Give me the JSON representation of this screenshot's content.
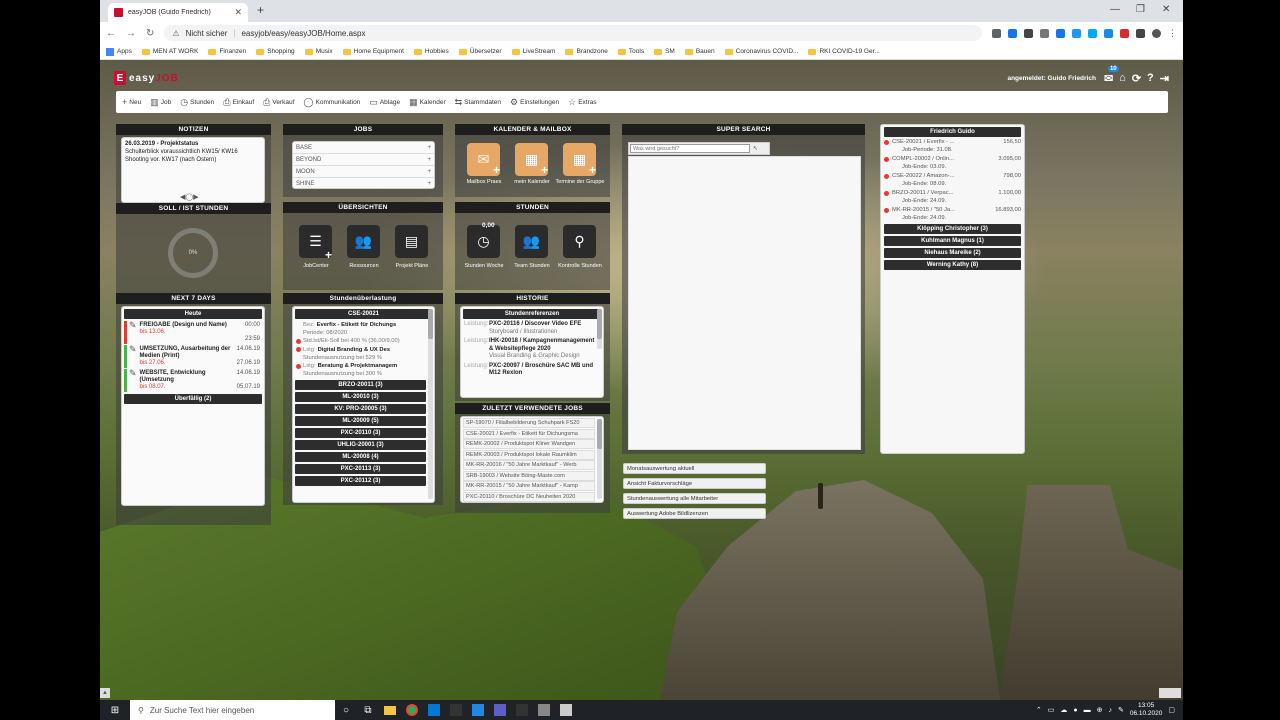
{
  "browser": {
    "tab_title": "easyJOB (Guido Friedrich)",
    "security_label": "Nicht sicher",
    "url": "easyjob/easy/easyJOB/Home.aspx",
    "bookmarks": [
      "Apps",
      "MEN AT WORK",
      "Finanzen",
      "Shopping",
      "Musix",
      "Home Equipment",
      "Hobbies",
      "Übersetzer",
      "LiveStream",
      "Brandzone",
      "Tools",
      "SM",
      "Bauen",
      "Coronavirus COVID...",
      "RKI COVID-19 Ger..."
    ]
  },
  "app": {
    "logo_easy": "easy",
    "logo_job": "JOB",
    "logged_in": "angemeldet: Guido Friedrich",
    "mail_badge": "10"
  },
  "toolbar": [
    "Neu",
    "Job",
    "Stunden",
    "Einkauf",
    "Verkauf",
    "Kommunikation",
    "Ablage",
    "Kalender",
    "Stammdaten",
    "Einstellungen",
    "Extras"
  ],
  "notizen": {
    "title": "NOTIZEN",
    "date_line": "26.03.2019 - Projektstatus",
    "line1": "Schulterblick voraussichtlich KW15/ KW16",
    "line2": "Shooting vor. KW17 (nach Ostern)"
  },
  "soll_ist": {
    "title": "SOLL / IST STUNDEN",
    "percent": "0%"
  },
  "next7": {
    "title": "NEXT 7 DAYS",
    "today": "Heute",
    "items": [
      {
        "title": "FREIGABE (Design und Name)",
        "time": "00:00",
        "due": "bis 13.06.",
        "time2": "23:59"
      },
      {
        "title": "UMSETZUNG, Ausarbeitung der Medien (Print)",
        "time": "14.06.19",
        "due": "bis 27.06.",
        "time2": "27.06.19"
      },
      {
        "title": "WEBSITE, Entwicklung (Umsetzung",
        "time": "14.06.19",
        "due": "bis 08.07.",
        "time2": "05.07.19"
      }
    ],
    "overdue": "Überfällig (2)"
  },
  "jobs": {
    "title": "JOBS",
    "items": [
      "BASE",
      "BEYOND",
      "MOON",
      "SHINE"
    ]
  },
  "uebersichten": {
    "title": "ÜBERSICHTEN",
    "items": [
      "JobCenter",
      "Ressourcen",
      "Projekt Pläne"
    ]
  },
  "stundenueber": {
    "title": "Stundenüberlastung",
    "head": "CSE-20021",
    "rows": [
      {
        "label": "Bez:",
        "text": "Everfix - Etikett für Dichungs",
        "bold": true,
        "dot": false
      },
      {
        "label": "",
        "text": "Periode: 08/2020",
        "bold": false,
        "dot": false
      },
      {
        "label": "",
        "text": "Std.Ist/Ek-Soll bei 400 % (36,00/9,00)",
        "bold": false,
        "dot": true
      },
      {
        "label": "Lstg:",
        "text": "Digital Branding & UX Des",
        "bold": true,
        "dot": true
      },
      {
        "label": "",
        "text": "Stundenausnutzung bei 529 %",
        "bold": false,
        "dot": false
      },
      {
        "label": "Lstg:",
        "text": "Beratung & Projektmanagem",
        "bold": true,
        "dot": true
      },
      {
        "label": "",
        "text": "Stundenausnutzung bei 300 %",
        "bold": false,
        "dot": false
      }
    ],
    "buttons": [
      "BRZO-20011 (3)",
      "ML-20010 (3)",
      "KV: PRO-20005 (3)",
      "ML-20009 (5)",
      "PXC-20110 (3)",
      "UHLIG-20001 (3)",
      "ML-20008 (4)",
      "PXC-20113 (3)",
      "PXC-20112 (3)"
    ]
  },
  "kalender": {
    "title": "KALENDER & MAILBOX",
    "items": [
      "Mailbox Praes",
      "mein Kalender",
      "Termine der Gruppe"
    ]
  },
  "stunden": {
    "title": "STUNDEN",
    "value": "0,00",
    "items": [
      "Stunden Woche",
      "Team Stunden",
      "Kontrolle Stunden"
    ]
  },
  "historie": {
    "title": "HISTORIE",
    "head": "Stundenreferenzen",
    "rows": [
      {
        "label": "Leistung:",
        "title": "PXC-20116 / Discover Video EFE",
        "sub": "Storyboard / Illustrationen"
      },
      {
        "label": "Leistung:",
        "title": "IHK-20018 / Kampagnenmanagement & Websitepflege 2020",
        "sub": "Visual Branding & Graphic Design"
      },
      {
        "label": "Leistung:",
        "title": "PXC-20097 / Broschüre SAC MB und M12 Rexlon",
        "sub": ""
      }
    ]
  },
  "zuletzt": {
    "title": "ZULETZT VERWENDETE JOBS",
    "items": [
      "SP-19070 / Filialbebilderung Schuhpark FS20",
      "CSE-20021 / Everfix - Etikett für Dichungsma",
      "REMK-20002 / Produktspot Kliner Wandgen",
      "REMK-20003 / Produktspot lokale Raumklim",
      "MK-RR-20016 / \"50 Jahre Marktkauf\" - Werb",
      "SRB-19003 / Website Böing-Maste.com",
      "MK-RR-20015 / \"50 Jahre Marktkauf\" - Kamp",
      "PXC-20110 / Broschüre DC Neuheiten 2020"
    ]
  },
  "supersearch": {
    "title": "SUPER SEARCH",
    "placeholder": "Was wird gesucht?"
  },
  "links": [
    "Monatsauswertung aktuell",
    "Ansicht Fakturvorschläge",
    "Stundenauswertung alle Mitarbeiter",
    "Auswertung Adobe Bildlizenzen"
  ],
  "friedrich": {
    "head": "Friedrich Guido",
    "rows": [
      {
        "job": "CSE-20021 / Everfix - ...",
        "amount": "156,50",
        "sub": "Job-Periode: 31.08."
      },
      {
        "job": "COMPL-20002 / Onlin...",
        "amount": "3.095,00",
        "sub": "Job-Ende: 03.09."
      },
      {
        "job": "CSE-20022 / Amazon-...",
        "amount": "798,00",
        "sub": "Job-Ende: 08.09."
      },
      {
        "job": "BRZO-20011 / Verpac...",
        "amount": "1.100,00",
        "sub": "Job-Ende: 24.09."
      },
      {
        "job": "MK-RR-20015 / \"50 Ja...",
        "amount": "16.893,00",
        "sub": "Job-Ende: 24.09."
      }
    ],
    "others": [
      "Klöpping Christopher (3)",
      "Kuhlmann Magnus (1)",
      "Niehaus Mareike (2)",
      "Werning Kathy (8)"
    ]
  },
  "taskbar": {
    "search_placeholder": "Zur Suche Text hier eingeben",
    "time": "13:05",
    "date": "06.10.2020"
  },
  "colors": {
    "brand": "#c8102e",
    "orange": "#e8a865",
    "alert": "#e53935",
    "badge": "#1e88e5"
  }
}
